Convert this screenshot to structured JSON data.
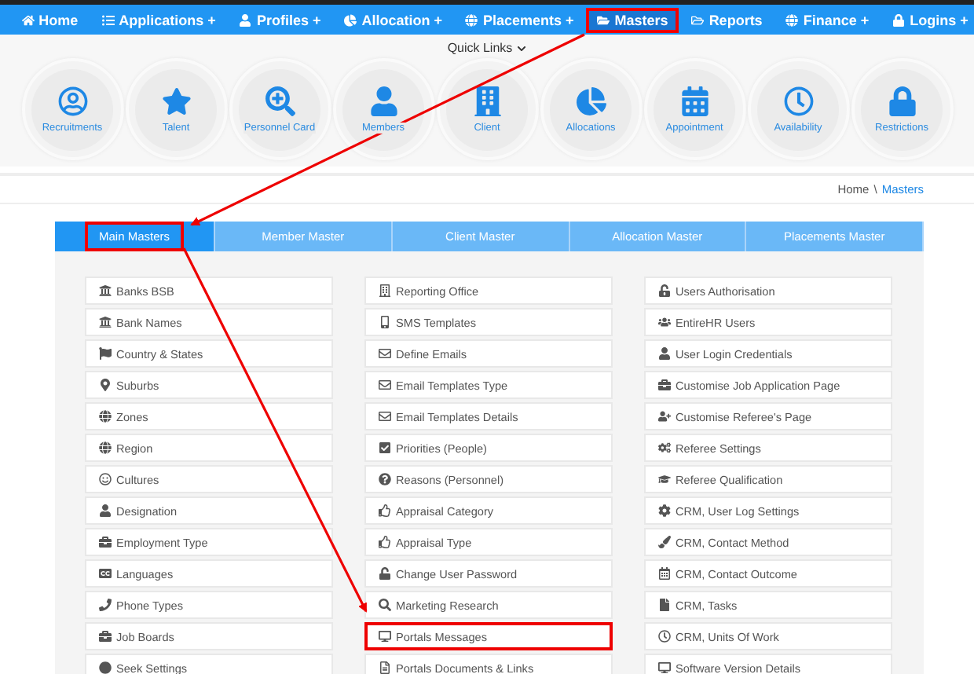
{
  "nav": [
    {
      "label": "Home",
      "highlighted": false
    },
    {
      "label": "Applications +",
      "highlighted": false
    },
    {
      "label": "Profiles +",
      "highlighted": false
    },
    {
      "label": "Allocation +",
      "highlighted": false
    },
    {
      "label": "Placements +",
      "highlighted": false
    },
    {
      "label": "Masters",
      "highlighted": true
    },
    {
      "label": "Reports",
      "highlighted": false
    },
    {
      "label": "Finance +",
      "highlighted": false
    },
    {
      "label": "Logins +",
      "highlighted": false
    }
  ],
  "quick_links": {
    "label": "Quick Links",
    "items": [
      "Recruitments",
      "Talent",
      "Personnel Card",
      "Members",
      "Client",
      "Allocations",
      "Appointment",
      "Availability",
      "Restrictions"
    ]
  },
  "breadcrumb": {
    "separator": "\\",
    "items": [
      {
        "label": "Home",
        "current": false
      },
      {
        "label": "Masters",
        "current": true
      }
    ]
  },
  "tabs": [
    {
      "label": "Main Masters",
      "selected": true,
      "highlighted": true
    },
    {
      "label": "Member Master",
      "selected": false,
      "highlighted": false
    },
    {
      "label": "Client Master",
      "selected": false,
      "highlighted": false
    },
    {
      "label": "Allocation Master",
      "selected": false,
      "highlighted": false
    },
    {
      "label": "Placements Master",
      "selected": false,
      "highlighted": false
    }
  ],
  "columns": [
    [
      {
        "label": "Banks BSB",
        "highlighted": false
      },
      {
        "label": "Bank Names",
        "highlighted": false
      },
      {
        "label": "Country & States",
        "highlighted": false
      },
      {
        "label": "Suburbs",
        "highlighted": false
      },
      {
        "label": "Zones",
        "highlighted": false
      },
      {
        "label": "Region",
        "highlighted": false
      },
      {
        "label": "Cultures",
        "highlighted": false
      },
      {
        "label": "Designation",
        "highlighted": false
      },
      {
        "label": "Employment Type",
        "highlighted": false
      },
      {
        "label": "Languages",
        "highlighted": false
      },
      {
        "label": "Phone Types",
        "highlighted": false
      },
      {
        "label": "Job Boards",
        "highlighted": false
      },
      {
        "label": "Seek Settings",
        "highlighted": false
      }
    ],
    [
      {
        "label": "Reporting Office",
        "highlighted": false
      },
      {
        "label": "SMS Templates",
        "highlighted": false
      },
      {
        "label": "Define Emails",
        "highlighted": false
      },
      {
        "label": "Email Templates Type",
        "highlighted": false
      },
      {
        "label": "Email Templates Details",
        "highlighted": false
      },
      {
        "label": "Priorities (People)",
        "highlighted": false
      },
      {
        "label": "Reasons (Personnel)",
        "highlighted": false
      },
      {
        "label": "Appraisal Category",
        "highlighted": false
      },
      {
        "label": "Appraisal Type",
        "highlighted": false
      },
      {
        "label": "Change User Password",
        "highlighted": false
      },
      {
        "label": "Marketing Research",
        "highlighted": false
      },
      {
        "label": "Portals Messages",
        "highlighted": true
      },
      {
        "label": "Portals Documents & Links",
        "highlighted": false
      }
    ],
    [
      {
        "label": "Users Authorisation",
        "highlighted": false
      },
      {
        "label": "EntireHR Users",
        "highlighted": false
      },
      {
        "label": "User Login Credentials",
        "highlighted": false
      },
      {
        "label": "Customise Job Application Page",
        "highlighted": false
      },
      {
        "label": "Customise Referee's Page",
        "highlighted": false
      },
      {
        "label": "Referee Settings",
        "highlighted": false
      },
      {
        "label": "Referee Qualification",
        "highlighted": false
      },
      {
        "label": "CRM, User Log Settings",
        "highlighted": false
      },
      {
        "label": "CRM, Contact Method",
        "highlighted": false
      },
      {
        "label": "CRM, Contact Outcome",
        "highlighted": false
      },
      {
        "label": "CRM, Tasks",
        "highlighted": false
      },
      {
        "label": "CRM, Units Of Work",
        "highlighted": false
      },
      {
        "label": "Software Version Details",
        "highlighted": false
      }
    ]
  ]
}
